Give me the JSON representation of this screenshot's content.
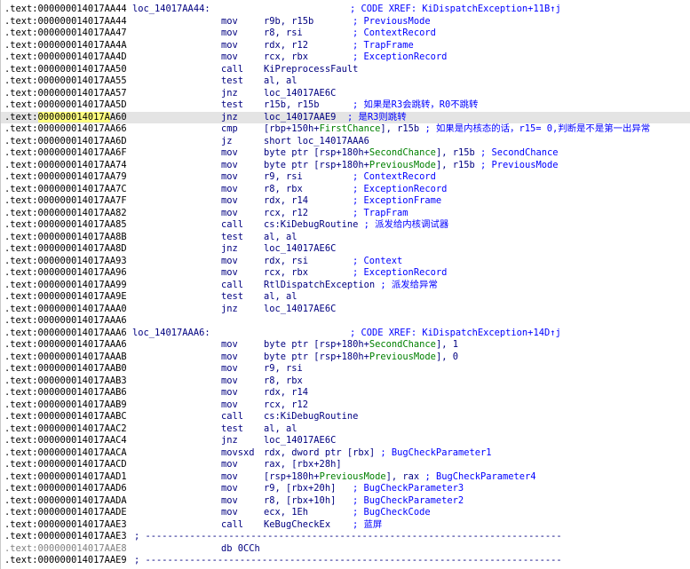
{
  "colors": {
    "address": "#000000",
    "mnemonic": "#000080",
    "comment": "#0000ff",
    "stack_var": "#008000",
    "highlight_row": "#e4e4e4",
    "cursor_highlight": "#ffff80",
    "gray_address": "#808080"
  },
  "lines": [
    {
      "addr": ".text:000000014017AA44",
      "label": "loc_14017AA44:",
      "xref": "; CODE XREF: KiDispatchException+11B↑j"
    },
    {
      "addr": ".text:000000014017AA44",
      "mn": "mov",
      "ops": [
        [
          "r9b, r15b",
          "v"
        ]
      ],
      "cmt": "; PreviousMode",
      "cmtX": 396
    },
    {
      "addr": ".text:000000014017AA47",
      "mn": "mov",
      "ops": [
        [
          "r8, rsi",
          "v"
        ]
      ],
      "cmt": "; ContextRecord",
      "cmtX": 396
    },
    {
      "addr": ".text:000000014017AA4A",
      "mn": "mov",
      "ops": [
        [
          "rdx, r12",
          "v"
        ]
      ],
      "cmt": "; TrapFrame",
      "cmtX": 396
    },
    {
      "addr": ".text:000000014017AA4D",
      "mn": "mov",
      "ops": [
        [
          "rcx, rbx",
          "v"
        ]
      ],
      "cmt": "; ExceptionRecord",
      "cmtX": 396
    },
    {
      "addr": ".text:000000014017AA50",
      "mn": "call",
      "ops": [
        [
          "KiPreprocessFault",
          "v"
        ]
      ]
    },
    {
      "addr": ".text:000000014017AA55",
      "mn": "test",
      "ops": [
        [
          "al, al",
          "v"
        ]
      ]
    },
    {
      "addr": ".text:000000014017AA57",
      "mn": "jnz",
      "ops": [
        [
          "loc_14017AE6C",
          "v"
        ]
      ]
    },
    {
      "addr": ".text:000000014017AA5D",
      "mn": "test",
      "ops": [
        [
          "r15b, r15b",
          "v"
        ]
      ],
      "cmt": "; 如果是R3会跳转，R0不跳转",
      "cmtX": 396
    },
    {
      "addr": ".text:000000014017AA60",
      "addrParts": [
        ".text:",
        "000000014017A",
        "A60"
      ],
      "highlight": true,
      "mn": "jnz",
      "ops": [
        [
          "loc_14017AAE9",
          "v"
        ]
      ],
      "cmt": "; 是R3则跳转",
      "cmtX": 390
    },
    {
      "addr": ".text:000000014017AA66",
      "mn": "cmp",
      "ops": [
        [
          "[rbp+150h+",
          "v"
        ],
        [
          "FirstChance",
          "k"
        ],
        [
          "], r15b ",
          "v"
        ],
        [
          "; 如果是内核态的话，r15= 0,判断是不是第一出异常",
          "c"
        ]
      ]
    },
    {
      "addr": ".text:000000014017AA6D",
      "mn": "jz",
      "ops": [
        [
          "short loc_14017AAA6",
          "v"
        ]
      ]
    },
    {
      "addr": ".text:000000014017AA6F",
      "mn": "mov",
      "ops": [
        [
          "byte ptr [rsp+180h+",
          "v"
        ],
        [
          "SecondChance",
          "k"
        ],
        [
          "], r15b ",
          "v"
        ],
        [
          "; SecondChance",
          "c"
        ]
      ]
    },
    {
      "addr": ".text:000000014017AA74",
      "mn": "mov",
      "ops": [
        [
          "byte ptr [rsp+180h+",
          "v"
        ],
        [
          "PreviousMode",
          "k"
        ],
        [
          "], r15b ",
          "v"
        ],
        [
          "; PreviousMode",
          "c"
        ]
      ]
    },
    {
      "addr": ".text:000000014017AA79",
      "mn": "mov",
      "ops": [
        [
          "r9, rsi",
          "v"
        ]
      ],
      "cmt": "; ContextRecord",
      "cmtX": 396
    },
    {
      "addr": ".text:000000014017AA7C",
      "mn": "mov",
      "ops": [
        [
          "r8, rbx",
          "v"
        ]
      ],
      "cmt": "; ExceptionRecord",
      "cmtX": 396
    },
    {
      "addr": ".text:000000014017AA7F",
      "mn": "mov",
      "ops": [
        [
          "rdx, r14",
          "v"
        ]
      ],
      "cmt": "; ExceptionFrame",
      "cmtX": 396
    },
    {
      "addr": ".text:000000014017AA82",
      "mn": "mov",
      "ops": [
        [
          "rcx, r12",
          "v"
        ]
      ],
      "cmt": "; TrapFram",
      "cmtX": 396
    },
    {
      "addr": ".text:000000014017AA85",
      "mn": "call",
      "ops": [
        [
          "cs:KiDebugRoutine ",
          "v"
        ],
        [
          "; 派发给内核调试器",
          "c"
        ]
      ]
    },
    {
      "addr": ".text:000000014017AA8B",
      "mn": "test",
      "ops": [
        [
          "al, al",
          "v"
        ]
      ]
    },
    {
      "addr": ".text:000000014017AA8D",
      "mn": "jnz",
      "ops": [
        [
          "loc_14017AE6C",
          "v"
        ]
      ]
    },
    {
      "addr": ".text:000000014017AA93",
      "mn": "mov",
      "ops": [
        [
          "rdx, rsi",
          "v"
        ]
      ],
      "cmt": "; Context",
      "cmtX": 396
    },
    {
      "addr": ".text:000000014017AA96",
      "mn": "mov",
      "ops": [
        [
          "rcx, rbx",
          "v"
        ]
      ],
      "cmt": "; ExceptionRecord",
      "cmtX": 396
    },
    {
      "addr": ".text:000000014017AA99",
      "mn": "call",
      "ops": [
        [
          "RtlDispatchException ",
          "v"
        ],
        [
          "; 派发给异常",
          "c"
        ]
      ]
    },
    {
      "addr": ".text:000000014017AA9E",
      "mn": "test",
      "ops": [
        [
          "al, al",
          "v"
        ]
      ]
    },
    {
      "addr": ".text:000000014017AAA0",
      "mn": "jnz",
      "ops": [
        [
          "loc_14017AE6C",
          "v"
        ]
      ]
    },
    {
      "addr": ".text:000000014017AAA6"
    },
    {
      "addr": ".text:000000014017AAA6",
      "label": "loc_14017AAA6:",
      "xref": "; CODE XREF: KiDispatchException+14D↑j"
    },
    {
      "addr": ".text:000000014017AAA6",
      "mn": "mov",
      "ops": [
        [
          "byte ptr [rsp+180h+",
          "v"
        ],
        [
          "SecondChance",
          "k"
        ],
        [
          "], 1",
          "v"
        ]
      ]
    },
    {
      "addr": ".text:000000014017AAAB",
      "mn": "mov",
      "ops": [
        [
          "byte ptr [rsp+180h+",
          "v"
        ],
        [
          "PreviousMode",
          "k"
        ],
        [
          "], 0",
          "v"
        ]
      ]
    },
    {
      "addr": ".text:000000014017AAB0",
      "mn": "mov",
      "ops": [
        [
          "r9, rsi",
          "v"
        ]
      ]
    },
    {
      "addr": ".text:000000014017AAB3",
      "mn": "mov",
      "ops": [
        [
          "r8, rbx",
          "v"
        ]
      ]
    },
    {
      "addr": ".text:000000014017AAB6",
      "mn": "mov",
      "ops": [
        [
          "rdx, r14",
          "v"
        ]
      ]
    },
    {
      "addr": ".text:000000014017AAB9",
      "mn": "mov",
      "ops": [
        [
          "rcx, r12",
          "v"
        ]
      ]
    },
    {
      "addr": ".text:000000014017AABC",
      "mn": "call",
      "ops": [
        [
          "cs:KiDebugRoutine",
          "v"
        ]
      ]
    },
    {
      "addr": ".text:000000014017AAC2",
      "mn": "test",
      "ops": [
        [
          "al, al",
          "v"
        ]
      ]
    },
    {
      "addr": ".text:000000014017AAC4",
      "mn": "jnz",
      "ops": [
        [
          "loc_14017AE6C",
          "v"
        ]
      ]
    },
    {
      "addr": ".text:000000014017AACA",
      "mn": "movsxd",
      "ops": [
        [
          "rdx, dword ptr [rbx] ",
          "v"
        ],
        [
          "; BugCheckParameter1",
          "c"
        ]
      ]
    },
    {
      "addr": ".text:000000014017AACD",
      "mn": "mov",
      "ops": [
        [
          "rax, [rbx+28h]",
          "v"
        ]
      ]
    },
    {
      "addr": ".text:000000014017AAD1",
      "mn": "mov",
      "ops": [
        [
          "[rsp+180h+",
          "v"
        ],
        [
          "PreviousMode",
          "k"
        ],
        [
          "], rax ",
          "v"
        ],
        [
          "; BugCheckParameter4",
          "c"
        ]
      ]
    },
    {
      "addr": ".text:000000014017AAD6",
      "mn": "mov",
      "ops": [
        [
          "r9, [rbx+20h]",
          "v"
        ]
      ],
      "cmt": "; BugCheckParameter3",
      "cmtX": 396
    },
    {
      "addr": ".text:000000014017AADA",
      "mn": "mov",
      "ops": [
        [
          "r8, [rbx+10h]",
          "v"
        ]
      ],
      "cmt": "; BugCheckParameter2",
      "cmtX": 396
    },
    {
      "addr": ".text:000000014017AADE",
      "mn": "mov",
      "ops": [
        [
          "ecx, 1Eh",
          "v"
        ]
      ],
      "cmt": "; BugCheckCode",
      "cmtX": 396
    },
    {
      "addr": ".text:000000014017AAE3",
      "mn": "call",
      "ops": [
        [
          "KeBugCheckEx",
          "v"
        ]
      ],
      "cmt": "; 蓝屏",
      "cmtX": 396
    },
    {
      "addr": ".text:000000014017AAE3",
      "sep": "; ---------------------------------------------------------------------------"
    },
    {
      "addr": ".text:000000014017AAE8",
      "gray": true,
      "mn": "db 0CCh"
    },
    {
      "addr": ".text:000000014017AAE9",
      "sep": "; ---------------------------------------------------------------------------"
    }
  ]
}
